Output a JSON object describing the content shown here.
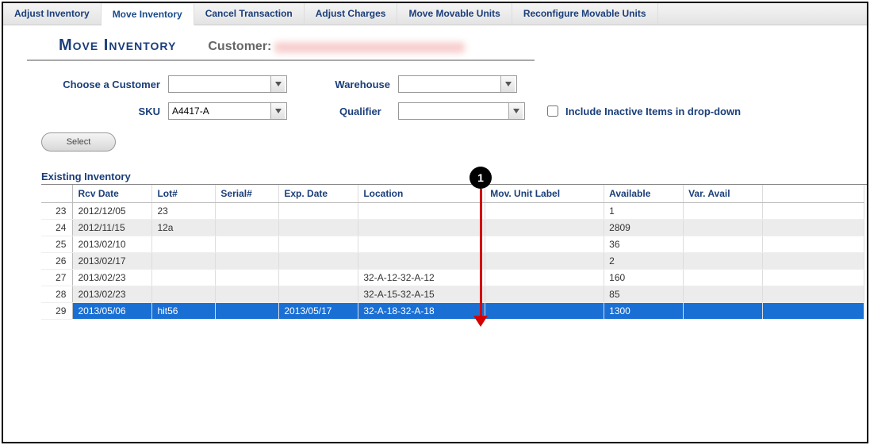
{
  "tabs": [
    {
      "label": "Adjust Inventory",
      "active": false
    },
    {
      "label": "Move Inventory",
      "active": true
    },
    {
      "label": "Cancel Transaction",
      "active": false
    },
    {
      "label": "Adjust Charges",
      "active": false
    },
    {
      "label": "Move Movable Units",
      "active": false
    },
    {
      "label": "Reconfigure Movable Units",
      "active": false
    }
  ],
  "page": {
    "title": "Move Inventory",
    "customer_label": "Customer:"
  },
  "filters": {
    "choose_customer_label": "Choose a Customer",
    "choose_customer_value": "",
    "warehouse_label": "Warehouse",
    "warehouse_value": "",
    "sku_label": "SKU",
    "sku_value": "A4417-A",
    "qualifier_label": "Qualifier",
    "qualifier_value": "",
    "include_inactive_label": "Include Inactive Items in drop-down",
    "include_inactive_checked": false,
    "select_button": "Select"
  },
  "section": {
    "existing_inventory": "Existing Inventory"
  },
  "table": {
    "columns": [
      "",
      "Rcv Date",
      "Lot#",
      "Serial#",
      "Exp. Date",
      "Location",
      "Mov. Unit Label",
      "Available",
      "Var. Avail",
      ""
    ],
    "rows": [
      {
        "n": "23",
        "rcv": "2012/12/05",
        "lot": "23",
        "serial": "",
        "exp": "",
        "loc": "",
        "mov": "",
        "avail": "1",
        "var": "",
        "sel": false,
        "parity": "odd"
      },
      {
        "n": "24",
        "rcv": "2012/11/15",
        "lot": "12a",
        "serial": "",
        "exp": "",
        "loc": "",
        "mov": "",
        "avail": "2809",
        "var": "",
        "sel": false,
        "parity": "even"
      },
      {
        "n": "25",
        "rcv": "2013/02/10",
        "lot": "",
        "serial": "",
        "exp": "",
        "loc": "",
        "mov": "",
        "avail": "36",
        "var": "",
        "sel": false,
        "parity": "odd"
      },
      {
        "n": "26",
        "rcv": "2013/02/17",
        "lot": "",
        "serial": "",
        "exp": "",
        "loc": "",
        "mov": "",
        "avail": "2",
        "var": "",
        "sel": false,
        "parity": "even"
      },
      {
        "n": "27",
        "rcv": "2013/02/23",
        "lot": "",
        "serial": "",
        "exp": "",
        "loc": "32-A-12-32-A-12",
        "mov": "",
        "avail": "160",
        "var": "",
        "sel": false,
        "parity": "odd"
      },
      {
        "n": "28",
        "rcv": "2013/02/23",
        "lot": "",
        "serial": "",
        "exp": "",
        "loc": "32-A-15-32-A-15",
        "mov": "",
        "avail": "85",
        "var": "",
        "sel": false,
        "parity": "even"
      },
      {
        "n": "29",
        "rcv": "2013/05/06",
        "lot": "hit56",
        "serial": "",
        "exp": "2013/05/17",
        "loc": "32-A-18-32-A-18",
        "mov": "",
        "avail": "1300",
        "var": "",
        "sel": true,
        "parity": "odd"
      }
    ]
  },
  "annotation": {
    "number": "1"
  }
}
